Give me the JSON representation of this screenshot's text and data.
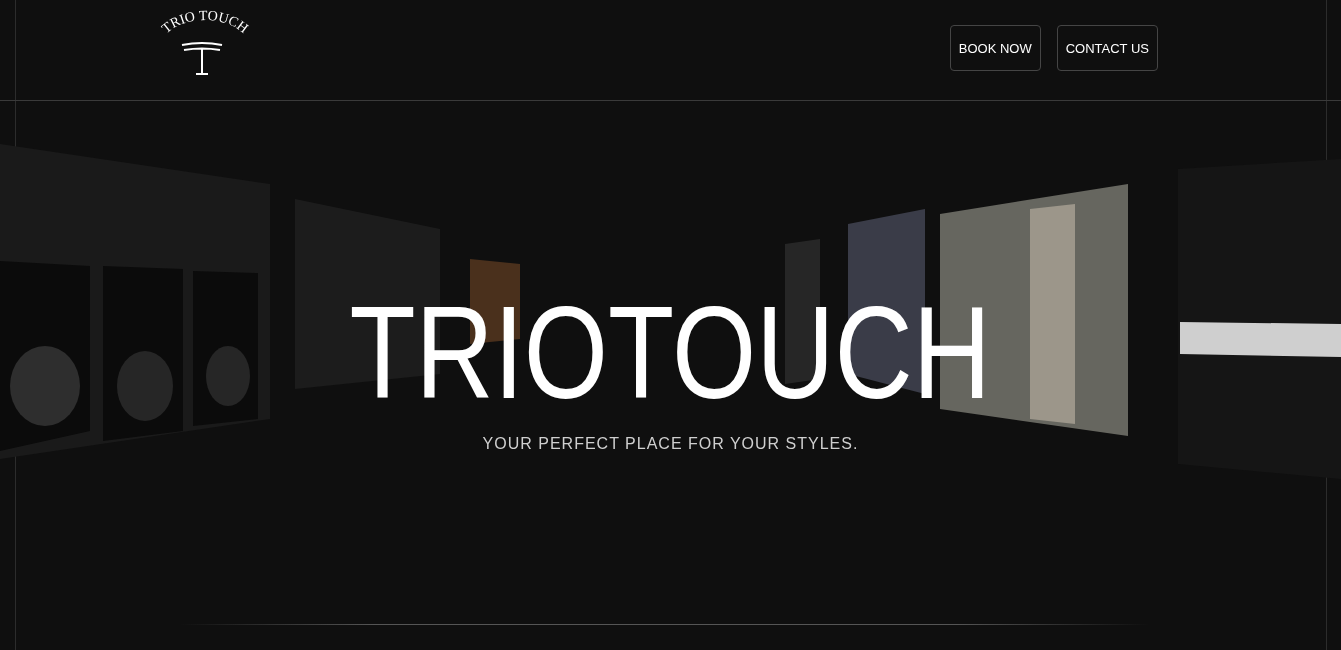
{
  "header": {
    "logo_text": "TRIO TOUCH",
    "buttons": [
      {
        "label": "BOOK NOW"
      },
      {
        "label": "CONTACT US"
      }
    ]
  },
  "hero": {
    "title": "TRIOTOUCH",
    "subtitle": "YOUR PERFECT PLACE FOR YOUR STYLES."
  }
}
